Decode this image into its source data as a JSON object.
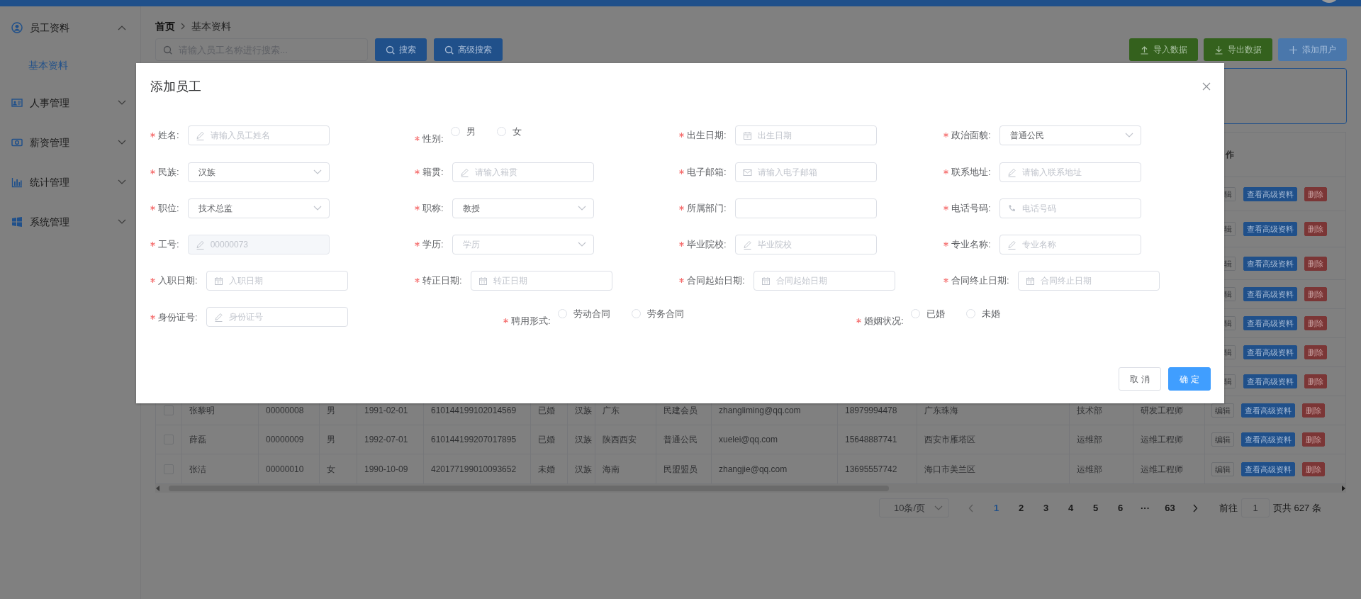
{
  "sidebar": {
    "items": [
      {
        "label": "员工资料",
        "expanded": true,
        "children": [
          {
            "label": "基本资料",
            "selected": true
          }
        ]
      },
      {
        "label": "人事管理",
        "expanded": false
      },
      {
        "label": "薪资管理",
        "expanded": false
      },
      {
        "label": "统计管理",
        "expanded": false
      },
      {
        "label": "系统管理",
        "expanded": false
      }
    ]
  },
  "breadcrumb": [
    "首页",
    "基本资料"
  ],
  "search": {
    "placeholder": "请输入员工名称进行搜索..."
  },
  "toolbar_left": [
    {
      "label": "搜索",
      "kind": "search"
    },
    {
      "label": "高级搜索",
      "kind": "search"
    }
  ],
  "toolbar_right": [
    {
      "label": "导入数据",
      "kind": "import"
    },
    {
      "label": "导出数据",
      "kind": "export"
    },
    {
      "label": "添加用户",
      "kind": "add"
    }
  ],
  "table": {
    "header_visible": "作",
    "partial_rows": [
      {
        "actions": [
          "辑",
          "查看高级资料",
          "删除"
        ]
      },
      {
        "actions": [
          "辑",
          "查看高级资料",
          "删除"
        ]
      },
      {
        "actions": [
          "辑",
          "查看高级资料",
          "删除"
        ]
      },
      {
        "actions": [
          "辑",
          "查看高级资料",
          "删除"
        ]
      },
      {
        "actions": [
          "辑",
          "查看高级资料",
          "删除"
        ]
      },
      {
        "actions": [
          "辑",
          "查看高级资料",
          "删除"
        ]
      },
      {
        "actions": [
          "辑",
          "查看高级资料",
          "删除"
        ]
      }
    ],
    "rows": [
      {
        "checked": false,
        "cells": [
          "张黎明",
          "00000008",
          "男",
          "1991-02-01",
          "610144199102014569",
          "已婚",
          "汉族",
          "广东",
          "民建会员",
          "zhangliming@qq.com",
          "18979994478",
          "广东珠海",
          "技术部",
          "研发工程师"
        ],
        "actions": [
          "编辑",
          "查看高级资料",
          "删除"
        ]
      },
      {
        "checked": false,
        "cells": [
          "薛磊",
          "00000009",
          "男",
          "1992-07-01",
          "610144199207017895",
          "已婚",
          "汉族",
          "陕西西安",
          "普通公民",
          "xuelei@qq.com",
          "15648887741",
          "西安市雁塔区",
          "运维部",
          "运维工程师"
        ],
        "actions": [
          "编辑",
          "查看高级资料",
          "删除"
        ]
      },
      {
        "checked": false,
        "cells": [
          "张洁",
          "00000010",
          "女",
          "1990-10-09",
          "420177199010093652",
          "未婚",
          "汉族",
          "海南",
          "民盟盟员",
          "zhangjie@qq.com",
          "13695557742",
          "海口市美兰区",
          "运维部",
          "运维工程师"
        ],
        "actions": [
          "编辑",
          "查看高级资料",
          "删除"
        ]
      }
    ]
  },
  "pagination": {
    "page_size": "10条/页",
    "pages": [
      {
        "label": "1",
        "selected": true
      },
      {
        "label": "2",
        "selected": false
      },
      {
        "label": "3",
        "selected": false
      },
      {
        "label": "4",
        "selected": false
      },
      {
        "label": "5",
        "selected": false
      },
      {
        "label": "6",
        "selected": false
      },
      {
        "label": "···",
        "selected": false
      },
      {
        "label": "63",
        "selected": false
      }
    ],
    "jump_label": "前往",
    "jump_value": "1",
    "total": "页共 627 条"
  },
  "dialog": {
    "title": "添加员工",
    "rows": [
      [
        {
          "label": "姓名:",
          "required": true,
          "kind": "text",
          "placeholder": "请输入员工姓名"
        },
        {
          "label": "性别:",
          "required": true,
          "kind": "radio",
          "options": [
            {
              "label": "男",
              "selected": false
            },
            {
              "label": "女",
              "selected": false
            }
          ]
        },
        {
          "label": "出生日期:",
          "required": true,
          "kind": "date",
          "placeholder": "出生日期"
        },
        {
          "label": "政治面貌:",
          "required": true,
          "kind": "select",
          "value": "普通公民"
        }
      ],
      [
        {
          "label": "民族:",
          "required": true,
          "kind": "select",
          "value": "汉族"
        },
        {
          "label": "籍贯:",
          "required": true,
          "kind": "text",
          "placeholder": "请输入籍贯"
        },
        {
          "label": "电子邮箱:",
          "required": true,
          "kind": "email",
          "placeholder": "请输入电子邮箱"
        },
        {
          "label": "联系地址:",
          "required": true,
          "kind": "text",
          "placeholder": "请输入联系地址"
        }
      ],
      [
        {
          "label": "职位:",
          "required": true,
          "kind": "select",
          "value": "技术总监"
        },
        {
          "label": "职称:",
          "required": true,
          "kind": "select",
          "value": "教授"
        },
        {
          "label": "所属部门:",
          "required": true,
          "kind": "plain"
        },
        {
          "label": "电话号码:",
          "required": true,
          "kind": "phone",
          "placeholder": "电话号码"
        }
      ],
      [
        {
          "label": "工号:",
          "required": true,
          "kind": "text",
          "value": "00000073",
          "disabled": true
        },
        {
          "label": "学历:",
          "required": true,
          "kind": "select",
          "placeholder": "学历"
        },
        {
          "label": "毕业院校:",
          "required": true,
          "kind": "text",
          "placeholder": "毕业院校"
        },
        {
          "label": "专业名称:",
          "required": true,
          "kind": "text",
          "placeholder": "专业名称"
        }
      ],
      [
        {
          "label": "入职日期:",
          "required": true,
          "kind": "date",
          "placeholder": "入职日期"
        },
        {
          "label": "转正日期:",
          "required": true,
          "kind": "date",
          "placeholder": "转正日期"
        },
        {
          "label": "合同起始日期:",
          "required": true,
          "kind": "date",
          "placeholder": "合同起始日期"
        },
        {
          "label": "合同终止日期:",
          "required": true,
          "kind": "date",
          "placeholder": "合同终止日期"
        }
      ],
      [
        {
          "label": "身份证号:",
          "required": true,
          "kind": "text",
          "placeholder": "身份证号"
        },
        {
          "label": "聘用形式:",
          "required": true,
          "kind": "radio",
          "options": [
            {
              "label": "劳动合同",
              "selected": false
            },
            {
              "label": "劳务合同",
              "selected": false
            }
          ]
        },
        {
          "label": "婚姻状况:",
          "required": true,
          "kind": "radio",
          "options": [
            {
              "label": "已婚",
              "selected": false
            },
            {
              "label": "未婚",
              "selected": false
            }
          ]
        }
      ]
    ],
    "buttons": [
      {
        "label": "取 消",
        "kind": "default"
      },
      {
        "label": "确 定",
        "kind": "primary"
      }
    ]
  }
}
